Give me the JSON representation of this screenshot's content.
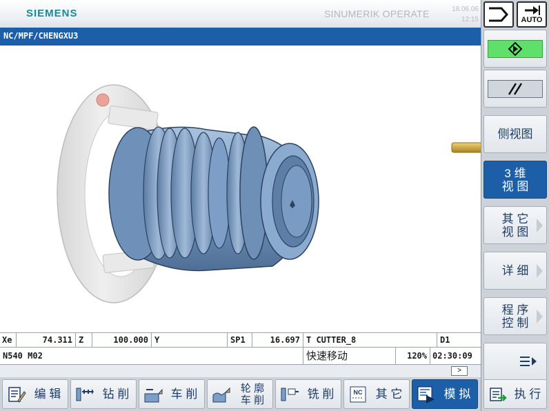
{
  "header": {
    "logo": "SIEMENS",
    "product": "SINUMERIK OPERATE",
    "date": "18.06.06",
    "time": "12:15"
  },
  "path": "NC/MPF/CHENGXU3",
  "axes": {
    "x_label": "Xe",
    "x_value": "74.311",
    "z_label": "Z",
    "z_value": "100.000",
    "y_label": "Y",
    "sp_label": "SP1",
    "sp_value": "16.697",
    "tool": "T CUTTER_8",
    "d": "D1"
  },
  "block": {
    "code": "N540 M02",
    "mode": "快速移动",
    "feed": "120%",
    "elapsed": "02:30:09"
  },
  "scroll_arrow": ">",
  "top_keys": {
    "channel_icon": "channel-switch-icon",
    "auto_label": "AUTO"
  },
  "right_softkeys": [
    {
      "label": "",
      "icon": "cycle-start-icon",
      "active": false
    },
    {
      "label": "",
      "icon": "parallel-lines-icon",
      "active": false
    },
    {
      "label": "侧视图",
      "active": false
    },
    {
      "label": "3 维\n视 图",
      "active": true
    },
    {
      "label": "其 它\n视 图",
      "active": false,
      "has_arrow": true
    },
    {
      "label": "详 细",
      "active": false,
      "has_arrow": true
    },
    {
      "label": "程 序\n控 制",
      "active": false,
      "has_arrow": true
    },
    {
      "label": "",
      "icon": "menu-more-icon",
      "active": false
    }
  ],
  "bottom_softkeys": [
    {
      "label": "编 辑",
      "icon": "edit-icon",
      "active": false
    },
    {
      "label": "钻 削",
      "icon": "drill-icon",
      "active": false
    },
    {
      "label": "车 削",
      "icon": "turning-icon",
      "active": false
    },
    {
      "label": "轮 廓\n车 削",
      "icon": "contour-turning-icon",
      "active": false
    },
    {
      "label": "铣 削",
      "icon": "milling-icon",
      "active": false
    },
    {
      "label": "其 它",
      "icon": "nc-other-icon",
      "active": false
    },
    {
      "label": "模 拟",
      "icon": "simulation-icon",
      "active": true
    },
    {
      "label": "执 行",
      "icon": "execute-icon",
      "active": false
    }
  ],
  "colors": {
    "brand": "#138a9e",
    "path_bar": "#1c5fa8",
    "active_key": "#1c5fa8",
    "key_text": "#1f3c66",
    "start_green": "#5fe06a",
    "part_blue": "#7d9fc7",
    "chuck_gray": "#e6e6e6",
    "tool_gold": "#d1a93a"
  }
}
